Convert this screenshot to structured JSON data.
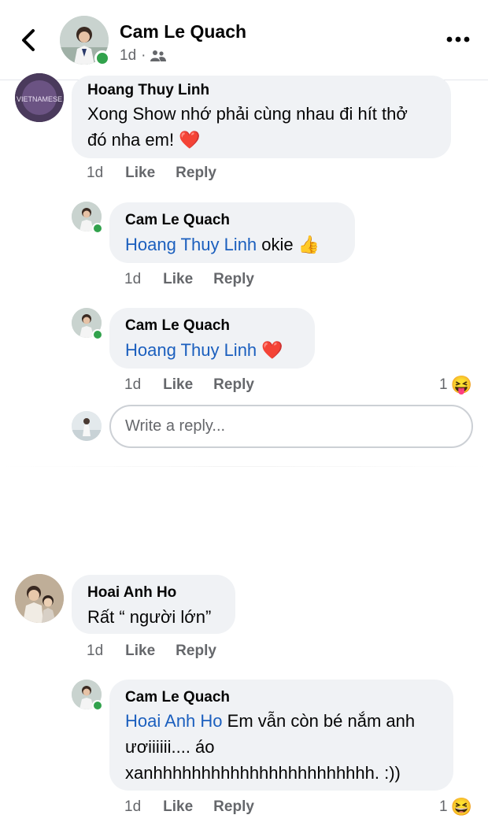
{
  "header": {
    "name": "Cam Le Quach",
    "time": "1d",
    "separator": "·",
    "audience_icon": "friends-icon"
  },
  "comments": [
    {
      "author": "Hoang Thuy Linh",
      "avatar_text": "VIETNAMESE",
      "line1": "Xong Show nhớ phải cùng nhau đi hít thở",
      "line2": "đó nha em! ❤️",
      "time": "1d",
      "like": "Like",
      "reply": "Reply"
    },
    {
      "author": "Cam Le Quach",
      "mention": "Hoang Thuy Linh",
      "text": " okie 👍",
      "time": "1d",
      "like": "Like",
      "reply": "Reply"
    },
    {
      "author": "Cam Le Quach",
      "mention": "Hoang Thuy Linh",
      "text": " ❤️",
      "time": "1d",
      "like": "Like",
      "reply": "Reply",
      "reaction_count": "1",
      "reaction_emoji": "😝"
    },
    {
      "author": "Hoai Anh Ho",
      "text": "Rất “ người lớn”",
      "time": "1d",
      "like": "Like",
      "reply": "Reply"
    },
    {
      "author": "Cam Le Quach",
      "mention": "Hoai Anh Ho",
      "line1_rest": " Em vẫn còn bé nắm anh",
      "line2": "ươiiiiii....  áo",
      "line3": "xanhhhhhhhhhhhhhhhhhhhhhhh. :))",
      "time": "1d",
      "like": "Like",
      "reply": "Reply",
      "reaction_count": "1",
      "reaction_emoji": "😆"
    }
  ],
  "reply_box": {
    "placeholder": "Write a reply..."
  },
  "colors": {
    "bubble": "#f0f2f5",
    "mention": "#1b5fbe",
    "online": "#31a24c",
    "meta": "#65676b"
  }
}
